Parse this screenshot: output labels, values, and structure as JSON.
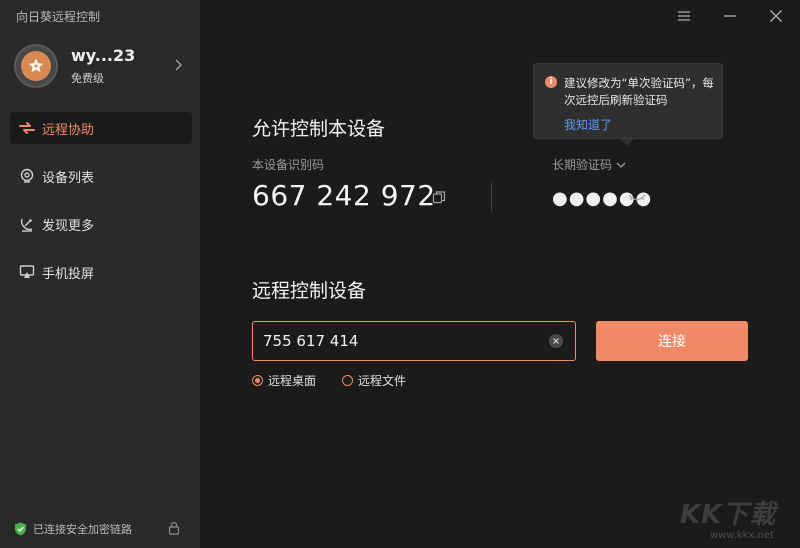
{
  "app": {
    "title": "向日葵远程控制"
  },
  "profile": {
    "name": "wy...23",
    "level": "免费级"
  },
  "nav": {
    "items": [
      {
        "label": "远程协助",
        "icon": "remote-assist-icon",
        "active": true
      },
      {
        "label": "设备列表",
        "icon": "device-list-icon",
        "active": false
      },
      {
        "label": "发现更多",
        "icon": "discover-icon",
        "active": false
      },
      {
        "label": "手机投屏",
        "icon": "screen-cast-icon",
        "active": false
      }
    ]
  },
  "footer": {
    "security_text": "已连接安全加密链路"
  },
  "allow_control": {
    "title": "允许控制本设备",
    "id_label": "本设备识别码",
    "device_id": "667 242 972",
    "code_label": "长期验证码",
    "code_masked": "●●●●●●"
  },
  "tooltip": {
    "message": "建议修改为“单次验证码”，每次远控后刷新验证码",
    "link": "我知道了"
  },
  "remote_control": {
    "title": "远程控制设备",
    "input_value": "755 617 414",
    "connect_label": "连接",
    "modes": [
      {
        "label": "远程桌面",
        "checked": true
      },
      {
        "label": "远程文件",
        "checked": false
      }
    ]
  },
  "watermark": {
    "big": "KK下载",
    "small": "www.kkx.net"
  },
  "colors": {
    "accent": "#f08968",
    "sidebar_bg": "#2a2a2b",
    "main_bg": "#1b1b1c",
    "link": "#5a9cf0",
    "secure": "#4caf50"
  }
}
